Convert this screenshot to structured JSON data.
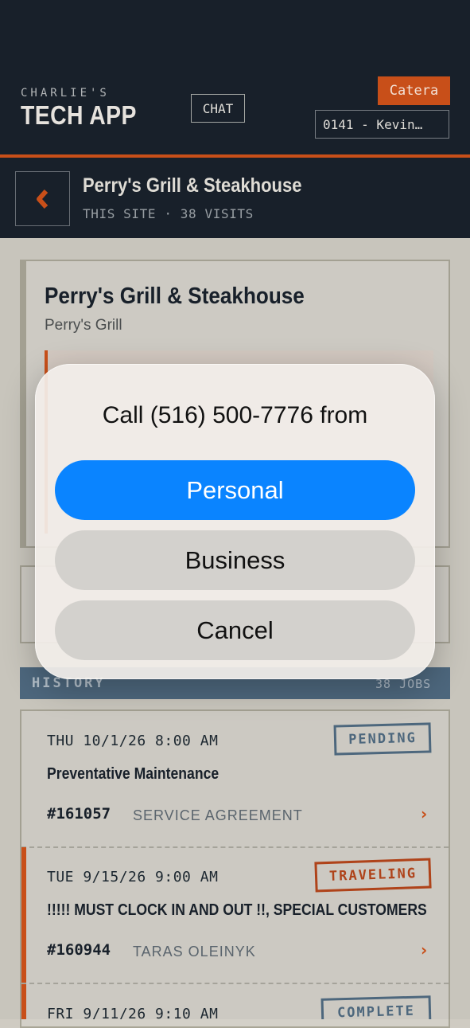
{
  "header": {
    "brand_small": "CHARLIE'S",
    "brand_big": "TECH APP",
    "chat_label": "CHAT",
    "catera_label": "Catera",
    "tech_selector": "0141 - Kevin…"
  },
  "site": {
    "title": "Perry's Grill & Steakhouse",
    "meta": "THIS SITE · 38 VISITS"
  },
  "customer_card": {
    "name": "Perry's Grill & Steakhouse",
    "subname": "Perry's Grill"
  },
  "history": {
    "label": "HISTORY",
    "count": "38 JOBS",
    "jobs": [
      {
        "date": "THU 10/1/26 8:00 AM",
        "title": "Preventative Maintenance",
        "number": "#161057",
        "assignee": "SERVICE AGREEMENT",
        "status": "PENDING",
        "status_color": "#4f6a80"
      },
      {
        "date": "TUE 9/15/26 9:00 AM",
        "title": "!!!!! MUST CLOCK IN AND OUT !!, SPECIAL CUSTOMERS",
        "number": "#160944",
        "assignee": "TARAS OLEINYK",
        "status": "TRAVELING",
        "status_color": "#b5441a"
      },
      {
        "date": "FRI 9/11/26 9:10 AM",
        "status": "COMPLETE",
        "status_color": "#4f6a80"
      }
    ]
  },
  "call_sheet": {
    "title": "Call (516) 500-7776 from",
    "personal": "Personal",
    "business": "Business",
    "cancel": "Cancel"
  },
  "icons": {
    "back": "chevron-left-icon",
    "job_open": "chevron-right-icon"
  },
  "colors": {
    "navy": "#17202a",
    "accent": "#cf5118",
    "primary_action": "#0a84ff",
    "slate": "#4f6a80"
  }
}
